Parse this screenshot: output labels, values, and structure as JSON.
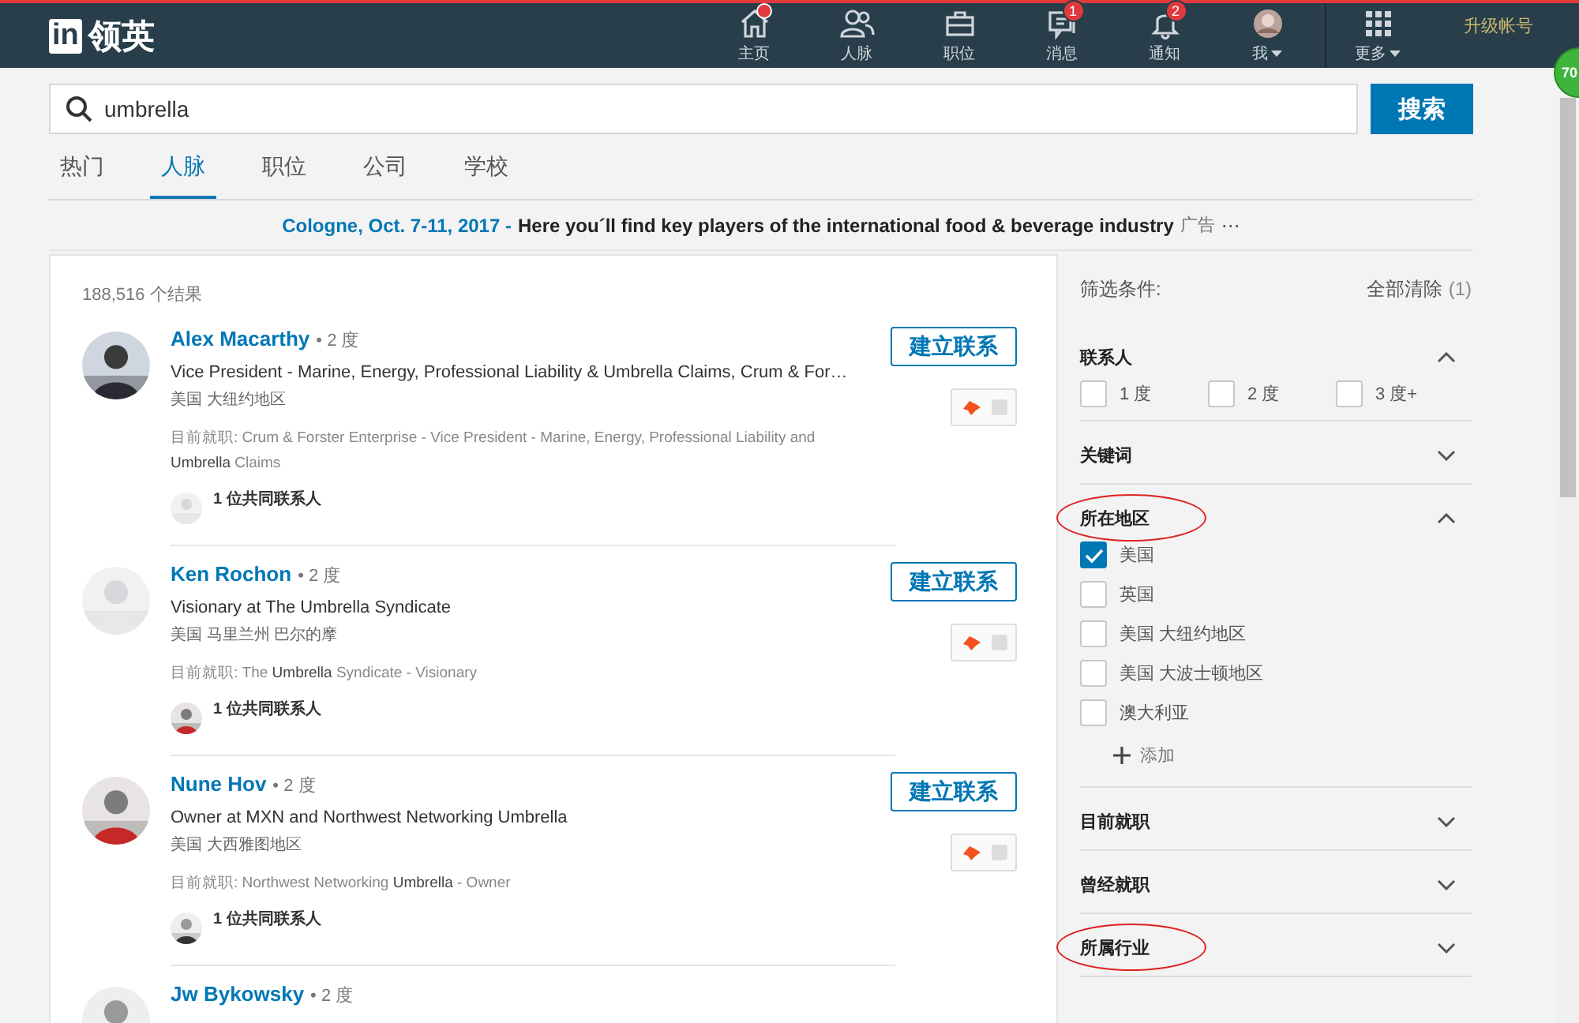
{
  "nav": {
    "logo_mark": "in",
    "logo_text": "领英",
    "items": [
      {
        "kind": "home",
        "label": "主页",
        "dot": true
      },
      {
        "kind": "people",
        "label": "人脉"
      },
      {
        "kind": "briefcase",
        "label": "职位"
      },
      {
        "kind": "messages",
        "label": "消息",
        "badge": "1"
      },
      {
        "kind": "bell",
        "label": "通知",
        "badge": "2"
      },
      {
        "kind": "avatar",
        "label": "我",
        "dropdown": true
      },
      {
        "kind": "grid",
        "label": "更多",
        "dropdown": true
      }
    ],
    "upgrade": "升级帐号"
  },
  "side_badge": "70",
  "search": {
    "value": "umbrella",
    "button": "搜索"
  },
  "tabs": [
    {
      "label": "热门",
      "selected": false
    },
    {
      "label": "人脉",
      "selected": true
    },
    {
      "label": "职位",
      "selected": false
    },
    {
      "label": "公司",
      "selected": false
    },
    {
      "label": "学校",
      "selected": false
    }
  ],
  "ad": {
    "link": "Cologne, Oct. 7-11, 2017 -",
    "text": "Here you´ll find key players of the international food & beverage industry",
    "label": "广告",
    "more": "⋯"
  },
  "results": {
    "count": "188,516 个结果",
    "people": [
      {
        "name": "Alex Macarthy",
        "degree": "• 2 度",
        "headline": "Vice President - Marine, Energy, Professional Liability & Umbrella Claims, Crum & For…",
        "location": "美国 大纽约地区",
        "current_label": "目前就职:",
        "current": "Crum & Forster Enterprise - Vice President - Marine, Energy, Professional Liability and **Umbrella** Claims",
        "shared": "1 位共同联系人",
        "connect": "建立联系"
      },
      {
        "name": "Ken Rochon",
        "degree": "• 2 度",
        "headline": "Visionary at The Umbrella Syndicate",
        "location": "美国 马里兰州 巴尔的摩",
        "current_label": "目前就职:",
        "current": "The **Umbrella** Syndicate - Visionary",
        "shared": "1 位共同联系人",
        "connect": "建立联系"
      },
      {
        "name": "Nune Hov",
        "degree": "• 2 度",
        "headline": "Owner at MXN and Northwest Networking Umbrella",
        "location": "美国 大西雅图地区",
        "current_label": "目前就职:",
        "current": "Northwest Networking **Umbrella** - Owner",
        "shared": "1 位共同联系人",
        "connect": "建立联系"
      },
      {
        "name": "Jw Bykowsky",
        "degree": "• 2 度"
      }
    ]
  },
  "filters": {
    "title": "筛选条件:",
    "clear": "全部清除",
    "clear_count": "(1)",
    "sections": [
      {
        "title": "联系人",
        "expanded": true,
        "kind": "inline",
        "options": [
          {
            "label": "1 度",
            "checked": false
          },
          {
            "label": "2 度",
            "checked": false
          },
          {
            "label": "3 度+",
            "checked": false
          }
        ]
      },
      {
        "title": "关键词",
        "expanded": false
      },
      {
        "title": "所在地区",
        "expanded": true,
        "highlighted": true,
        "kind": "list",
        "options": [
          {
            "label": "美国",
            "checked": true
          },
          {
            "label": "英国",
            "checked": false
          },
          {
            "label": "美国 大纽约地区",
            "checked": false
          },
          {
            "label": "美国 大波士顿地区",
            "checked": false
          },
          {
            "label": "澳大利亚",
            "checked": false
          }
        ],
        "add": "添加"
      },
      {
        "title": "目前就职",
        "expanded": false
      },
      {
        "title": "曾经就职",
        "expanded": false
      },
      {
        "title": "所属行业",
        "expanded": false,
        "highlighted": true
      }
    ]
  }
}
